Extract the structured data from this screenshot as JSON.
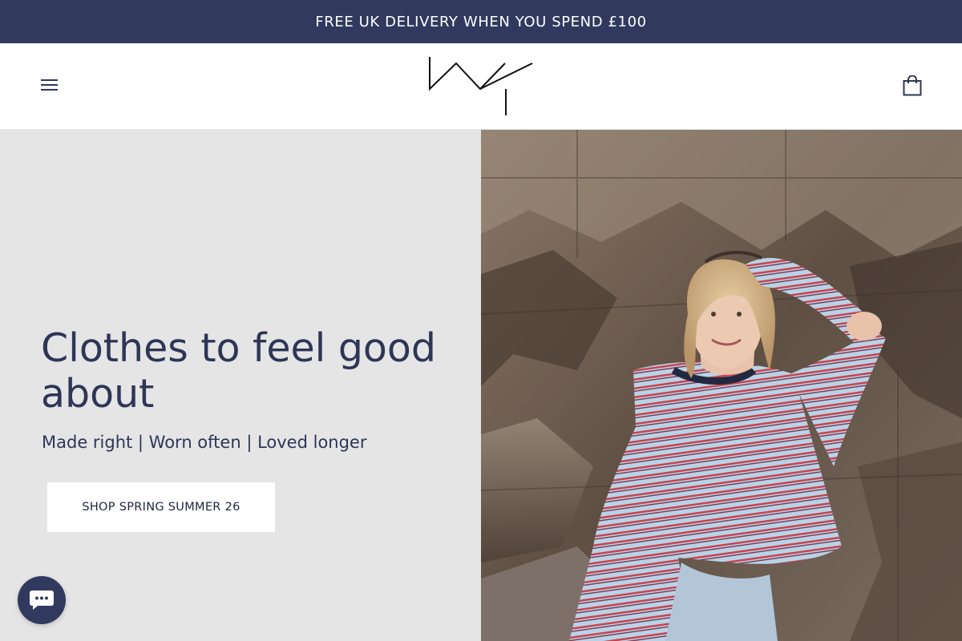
{
  "announcement": {
    "text": "FREE UK DELIVERY WHEN YOU SPEND £100"
  },
  "header": {
    "logo_text": "MY",
    "menu_icon": "hamburger-menu-icon",
    "cart_icon": "shopping-bag-icon"
  },
  "hero": {
    "title": "Clothes to feel good about",
    "subtitle": "Made right | Worn often | Loved longer",
    "cta_label": "SHOP SPRING SUMMER 26",
    "image_subject": "woman in striped long-sleeve top on rocky cliffs"
  },
  "chat": {
    "icon": "chat-bubble-icon"
  },
  "colors": {
    "brand_navy": "#313a5e",
    "heading_navy": "#2d3657",
    "hero_panel_grey": "#e5e5e5"
  }
}
